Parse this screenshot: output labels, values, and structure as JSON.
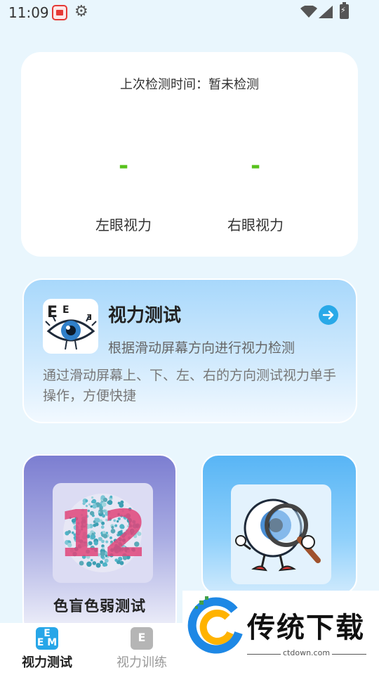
{
  "status_bar": {
    "time": "11:09",
    "icons": [
      "notification-icon",
      "gear-icon",
      "wifi-icon",
      "signal-icon",
      "battery-icon"
    ]
  },
  "record": {
    "time_label": "上次检测时间：",
    "time_value": "暂未检测",
    "left_eye": {
      "value": "-",
      "label": "左眼视力"
    },
    "right_eye": {
      "value": "-",
      "label": "右眼视力"
    }
  },
  "vision_test": {
    "title": "视力测试",
    "subtitle": "根据滑动屏幕方向进行视力检测",
    "description": "通过滑动屏幕上、下、左、右的方向测试视力单手操作，方便快捷",
    "icon": "eye-chart-icon",
    "arrow_icon": "arrow-right-icon"
  },
  "color_test": {
    "title": "色盲色弱测试",
    "plate_number": "12",
    "icon": "color-plate-icon"
  },
  "magnify_test": {
    "icon": "eyeball-magnifier-icon"
  },
  "tabs": [
    {
      "label": "视力测试",
      "icon_text": "E\nE M",
      "active": true
    },
    {
      "label": "视力训练",
      "icon_text": "E",
      "active": false
    }
  ],
  "watermark": {
    "title": "传统下载",
    "url": "ctdown.com"
  },
  "colors": {
    "accent": "#29a9e8",
    "value_green": "#58c21d",
    "background": "#e9f6fd"
  }
}
